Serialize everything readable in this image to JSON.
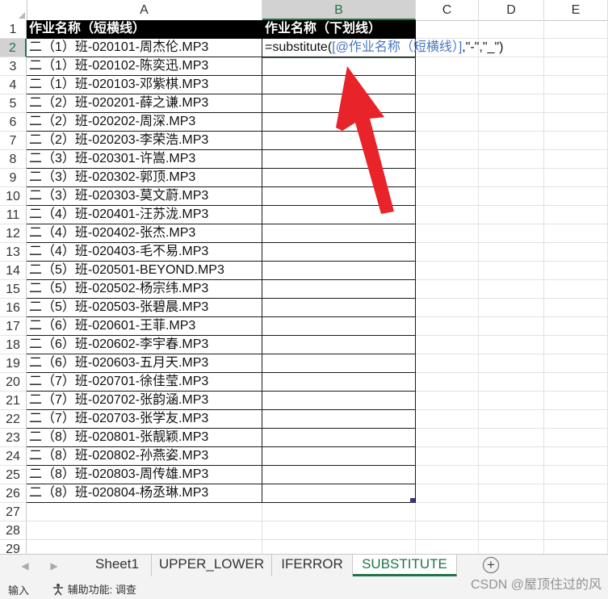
{
  "columns": [
    "A",
    "B",
    "C",
    "D",
    "E"
  ],
  "rows": [
    "1",
    "2",
    "3",
    "4",
    "5",
    "6",
    "7",
    "8",
    "9",
    "10",
    "11",
    "12",
    "13",
    "14",
    "15",
    "16",
    "17",
    "18",
    "19",
    "20",
    "21",
    "22",
    "23",
    "24",
    "25",
    "26",
    "27",
    "28",
    "29"
  ],
  "header": {
    "a1": "作业名称（短横线）",
    "b1": "作业名称（下划线）"
  },
  "formula": {
    "prefix": "=substitute(",
    "ref": "[@作业名称（短横线）]",
    "suffix": ",\"-\",\"_\")"
  },
  "items": [
    "二（1）班-020101-周杰伦.MP3",
    "二（1）班-020102-陈奕迅.MP3",
    "二（1）班-020103-邓紫棋.MP3",
    "二（2）班-020201-薛之谦.MP3",
    "二（2）班-020202-周深.MP3",
    "二（2）班-020203-李荣浩.MP3",
    "二（3）班-020301-许嵩.MP3",
    "二（3）班-020302-郭顶.MP3",
    "二（3）班-020303-莫文蔚.MP3",
    "二（4）班-020401-汪苏泷.MP3",
    "二（4）班-020402-张杰.MP3",
    "二（4）班-020403-毛不易.MP3",
    "二（5）班-020501-BEYOND.MP3",
    "二（5）班-020502-杨宗纬.MP3",
    "二（5）班-020503-张碧晨.MP3",
    "二（6）班-020601-王菲.MP3",
    "二（6）班-020602-李宇春.MP3",
    "二（6）班-020603-五月天.MP3",
    "二（7）班-020701-徐佳莹.MP3",
    "二（7）班-020702-张韵涵.MP3",
    "二（7）班-020703-张学友.MP3",
    "二（8）班-020801-张靓颖.MP3",
    "二（8）班-020802-孙燕姿.MP3",
    "二（8）班-020803-周传雄.MP3",
    "二（8）班-020804-杨丞琳.MP3"
  ],
  "tabs": [
    "Sheet1",
    "UPPER_LOWER",
    "IFERROR",
    "SUBSTITUTE"
  ],
  "active_tab": "SUBSTITUTE",
  "status": {
    "mode": "输入",
    "accessibility": "辅助功能: 调查"
  },
  "watermark": "CSDN @屋顶住过的风",
  "colors": {
    "accent": "#217346",
    "arrow": "#e8232a",
    "ref": "#4a76c0",
    "header_bg": "#000000"
  },
  "icons": {
    "add_sheet": "plus-circle-icon",
    "prev": "chevron-left-icon",
    "next": "chevron-right-icon",
    "accessibility": "accessibility-icon"
  }
}
